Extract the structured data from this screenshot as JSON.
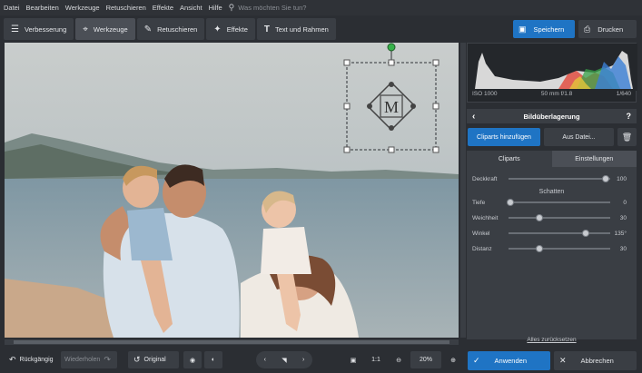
{
  "menu": {
    "items": [
      "Datei",
      "Bearbeiten",
      "Werkzeuge",
      "Retuschieren",
      "Effekte",
      "Ansicht",
      "Hilfe"
    ],
    "search_placeholder": "Was möchten Sie tun?"
  },
  "toolbar": {
    "tabs": [
      {
        "label": "Verbesserung",
        "icon": "sliders-icon"
      },
      {
        "label": "Werkzeuge",
        "icon": "crop-icon"
      },
      {
        "label": "Retuschieren",
        "icon": "brush-icon"
      },
      {
        "label": "Effekte",
        "icon": "magic-wand-icon"
      },
      {
        "label": "Text und Rahmen",
        "icon": "text-icon"
      }
    ],
    "active_tab": "Werkzeuge",
    "save_label": "Speichern",
    "print_label": "Drucken"
  },
  "histogram": {
    "iso": "ISO 1000",
    "focal": "50 mm f/1.8",
    "shutter": "1/640"
  },
  "panel": {
    "title": "Bildüberlagerung",
    "add_clipart": "Cliparts hinzufügen",
    "from_file": "Aus Datei...",
    "subtabs": [
      "Cliparts",
      "Einstellungen"
    ],
    "active_subtab": "Einstellungen",
    "opacity": {
      "label": "Deckkraft",
      "value": "100",
      "fraction": 0.95
    },
    "shadow_title": "Schatten",
    "depth": {
      "label": "Tiefe",
      "value": "0",
      "fraction": 0.0
    },
    "softness": {
      "label": "Weichheit",
      "value": "30",
      "fraction": 0.3
    },
    "angle": {
      "label": "Winkel",
      "value": "135°",
      "fraction": 0.75
    },
    "distance": {
      "label": "Distanz",
      "value": "30",
      "fraction": 0.3
    },
    "reset_label": "Alles zurücksetzen"
  },
  "clipart": {
    "letter": "M"
  },
  "bottombar": {
    "undo": "Rückgängig",
    "redo": "Wiederholen",
    "original": "Original",
    "ratio": "1:1",
    "zoom": "20%",
    "apply": "Anwenden",
    "cancel": "Abbrechen"
  },
  "colors": {
    "accent": "#1f74c4",
    "background": "#2b2e33",
    "panel": "#3a3e44"
  }
}
